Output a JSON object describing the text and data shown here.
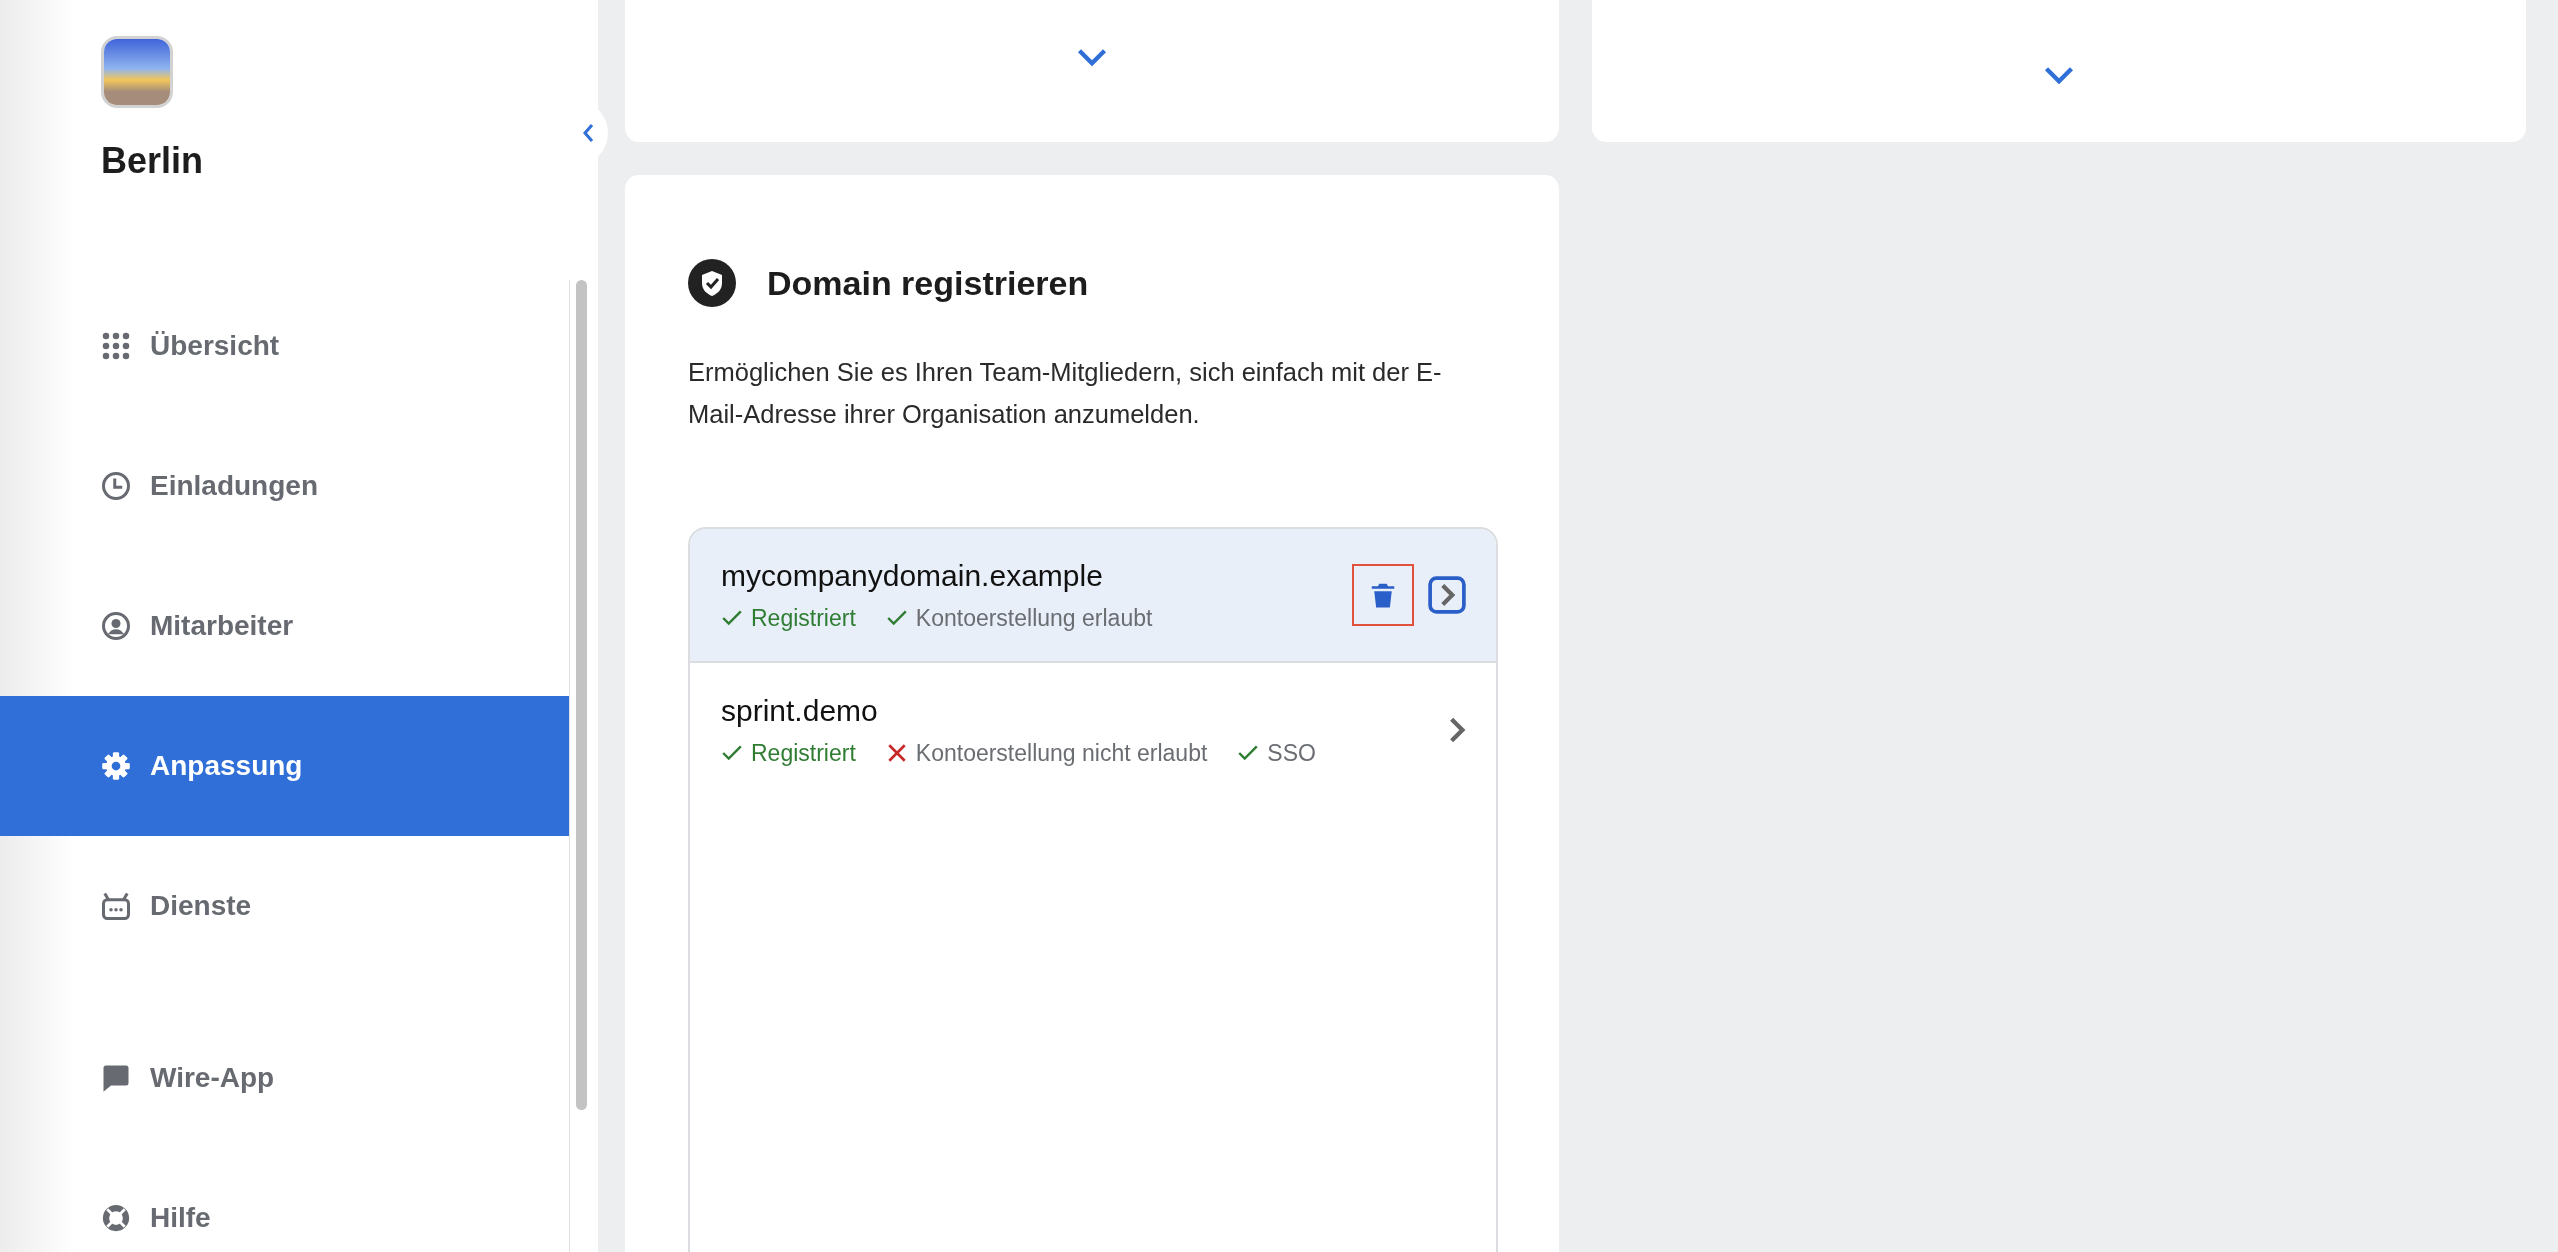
{
  "sidebar": {
    "team_name": "Berlin",
    "nav": [
      {
        "label": "Übersicht",
        "selected": false
      },
      {
        "label": "Einladungen",
        "selected": false
      },
      {
        "label": "Mitarbeiter",
        "selected": false
      },
      {
        "label": "Anpassung",
        "selected": true
      },
      {
        "label": "Dienste",
        "selected": false
      }
    ],
    "footer_nav": [
      {
        "label": "Wire-App",
        "selected": false
      },
      {
        "label": "Hilfe",
        "selected": false
      }
    ]
  },
  "domain_card": {
    "title": "Domain registrieren",
    "description": "Ermöglichen Sie es Ihren Team-Mitgliedern, sich einfach mit der E-Mail-Adresse ihrer Organisation anzumelden.",
    "domains": [
      {
        "name": "mycompanydomain.example",
        "selected": true,
        "tags": [
          {
            "label": "Registriert",
            "ok": true,
            "emphasized": true
          },
          {
            "label": "Kontoerstellung erlaubt",
            "ok": true,
            "emphasized": false
          }
        ]
      },
      {
        "name": "sprint.demo",
        "selected": false,
        "tags": [
          {
            "label": "Registriert",
            "ok": true,
            "emphasized": true
          },
          {
            "label": "Kontoerstellung nicht erlaubt",
            "ok": false,
            "emphasized": false
          },
          {
            "label": "SSO",
            "ok": true,
            "emphasized": false
          }
        ]
      }
    ]
  }
}
